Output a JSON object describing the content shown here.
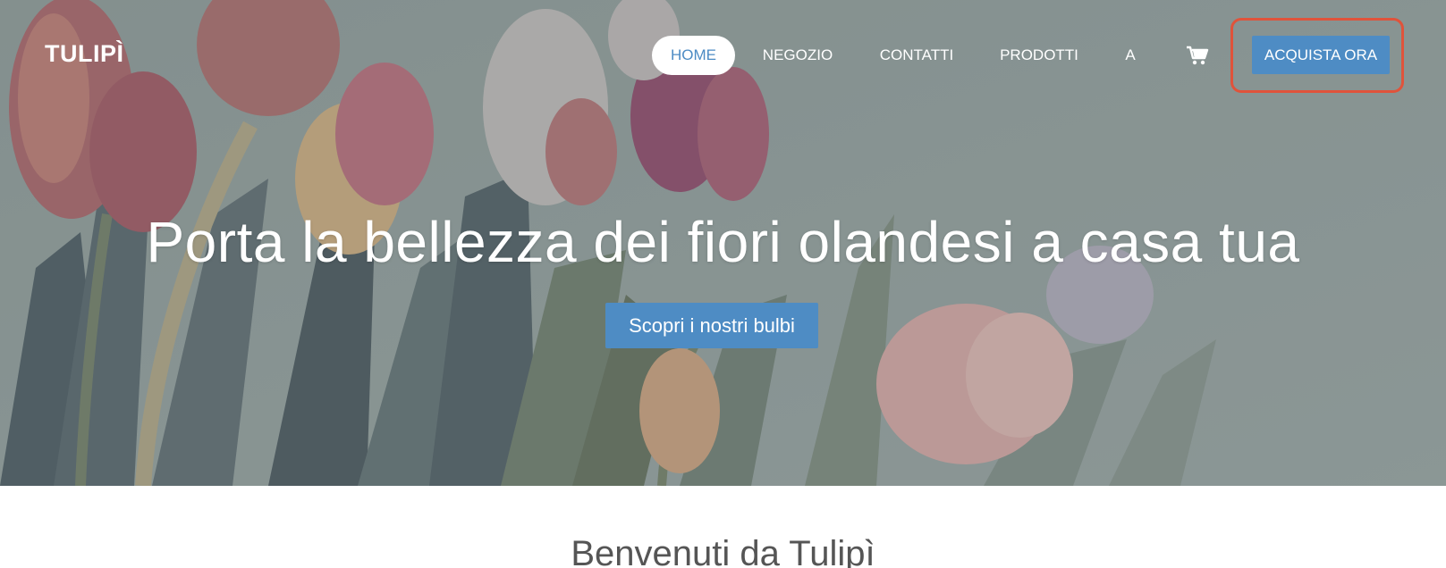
{
  "brand": {
    "name": "TULIPÌ"
  },
  "nav": {
    "items": [
      {
        "label": "HOME",
        "active": true
      },
      {
        "label": "NEGOZIO",
        "active": false
      },
      {
        "label": "CONTATTI",
        "active": false
      },
      {
        "label": "PRODOTTI",
        "active": false
      },
      {
        "label": "A",
        "active": false
      }
    ],
    "cart_icon": "shopping-cart-icon",
    "buy_label": "ACQUISTA ORA"
  },
  "hero": {
    "headline": "Porta la bellezza dei fiori olandesi a casa tua",
    "cta_label": "Scopri i nostri bulbi"
  },
  "welcome": {
    "title": "Benvenuti da Tulipì"
  },
  "colors": {
    "accent": "#4e8cc4",
    "highlight": "#e0533b",
    "hero_overlay": "#8c9a98"
  }
}
